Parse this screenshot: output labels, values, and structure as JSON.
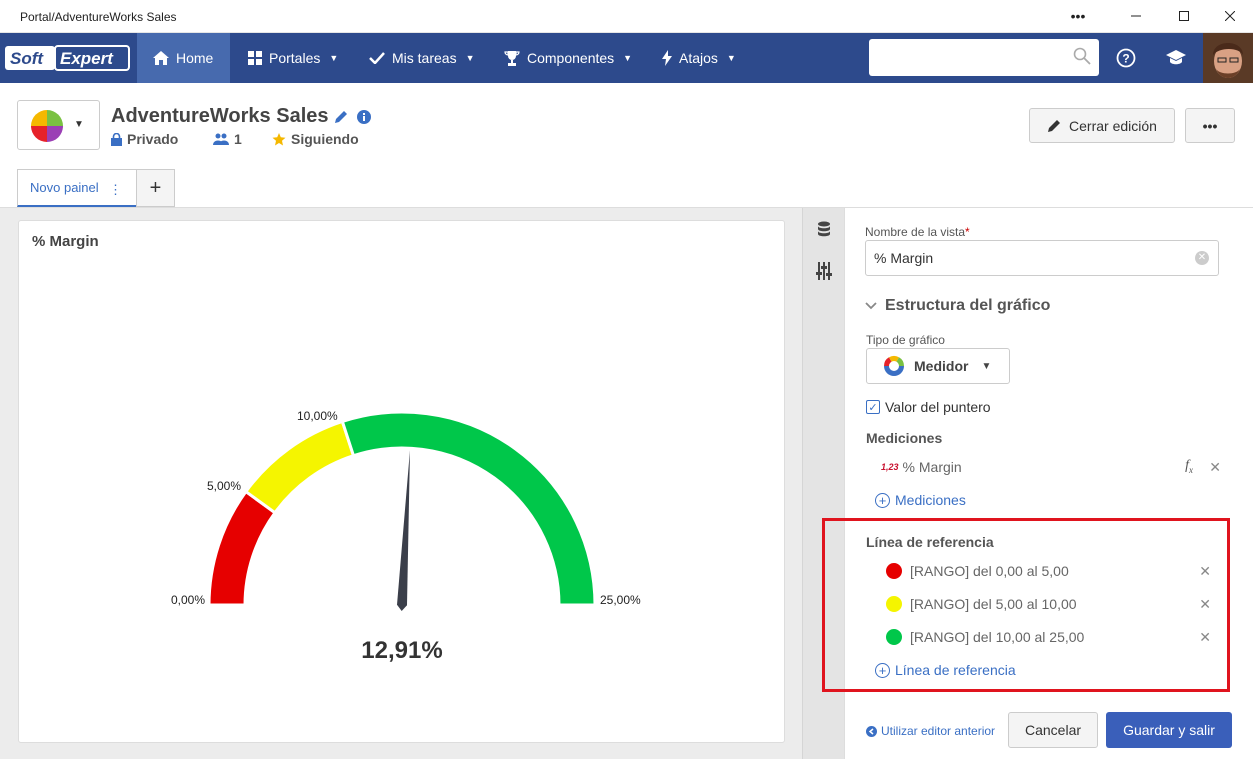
{
  "window": {
    "title": "Portal/AdventureWorks Sales"
  },
  "nav": {
    "items": [
      {
        "label": "Home"
      },
      {
        "label": "Portales"
      },
      {
        "label": "Mis tareas"
      },
      {
        "label": "Componentes"
      },
      {
        "label": "Atajos"
      }
    ],
    "search_placeholder": ""
  },
  "header": {
    "title": "AdventureWorks Sales",
    "privacy": "Privado",
    "members": "1",
    "following": "Siguiendo",
    "close_edit": "Cerrar edición"
  },
  "tabs": {
    "active": "Novo painel"
  },
  "card": {
    "title": "% Margin",
    "gauge": {
      "min_label": "0,00%",
      "t1_label": "5,00%",
      "t2_label": "10,00%",
      "max_label": "25,00%",
      "value_label": "12,91%",
      "min": 0,
      "max": 25,
      "value": 12.91,
      "ranges": [
        {
          "from": 0,
          "to": 5,
          "color": "#e60000"
        },
        {
          "from": 5,
          "to": 10,
          "color": "#f5f500"
        },
        {
          "from": 10,
          "to": 25,
          "color": "#00c74a"
        }
      ]
    }
  },
  "panel": {
    "view_name_label": "Nombre de la vista",
    "view_name_value": "% Margin",
    "structure_title": "Estructura del gráfico",
    "chart_type_label": "Tipo de gráfico",
    "chart_type_value": "Medidor",
    "pointer_value_label": "Valor del puntero",
    "measures_title": "Mediciones",
    "measure_badge": "1,23",
    "measure_item": "% Margin",
    "add_measure": "Mediciones",
    "refline_title": "Línea de referencia",
    "ranges": [
      {
        "label": "[RANGO] del 0,00 al 5,00",
        "color": "#e60000"
      },
      {
        "label": "[RANGO] del 5,00 al 10,00",
        "color": "#f5f500"
      },
      {
        "label": "[RANGO] del 10,00 al 25,00",
        "color": "#00c74a"
      }
    ],
    "add_refline": "Línea de referencia",
    "prev_editor": "Utilizar editor anterior",
    "cancel": "Cancelar",
    "save": "Guardar y salir"
  }
}
